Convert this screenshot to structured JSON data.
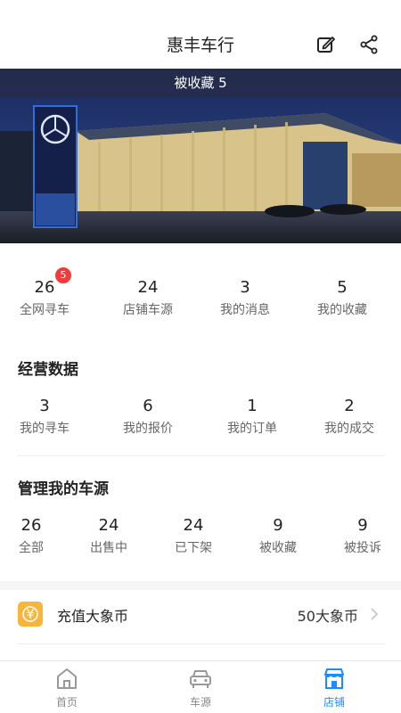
{
  "header": {
    "title": "惠丰车行",
    "edit_icon": "edit-icon",
    "share_icon": "share-icon"
  },
  "banner": {
    "favorited_label": "被收藏 5"
  },
  "top_stats": [
    {
      "value": "26",
      "label": "全网寻车",
      "badge": "5"
    },
    {
      "value": "24",
      "label": "店铺车源"
    },
    {
      "value": "3",
      "label": "我的消息"
    },
    {
      "value": "5",
      "label": "我的收藏"
    }
  ],
  "business": {
    "title": "经营数据",
    "items": [
      {
        "value": "3",
        "label": "我的寻车"
      },
      {
        "value": "6",
        "label": "我的报价"
      },
      {
        "value": "1",
        "label": "我的订单"
      },
      {
        "value": "2",
        "label": "我的成交"
      }
    ]
  },
  "inventory": {
    "title": "管理我的车源",
    "items": [
      {
        "value": "26",
        "label": "全部"
      },
      {
        "value": "24",
        "label": "出售中"
      },
      {
        "value": "24",
        "label": "已下架"
      },
      {
        "value": "9",
        "label": "被收藏"
      },
      {
        "value": "9",
        "label": "被投诉"
      }
    ]
  },
  "recharge": {
    "icon_text": "¥",
    "label": "充值大象币",
    "value": "50大象币"
  },
  "tabbar": [
    {
      "label": "首页",
      "icon": "home-icon",
      "active": false
    },
    {
      "label": "车源",
      "icon": "car-icon",
      "active": false
    },
    {
      "label": "店铺",
      "icon": "store-icon",
      "active": true
    }
  ],
  "colors": {
    "accent": "#1a8cff",
    "badge": "#f33b3b",
    "coin": "#fbb43a",
    "gap": "#f4f5f7"
  }
}
